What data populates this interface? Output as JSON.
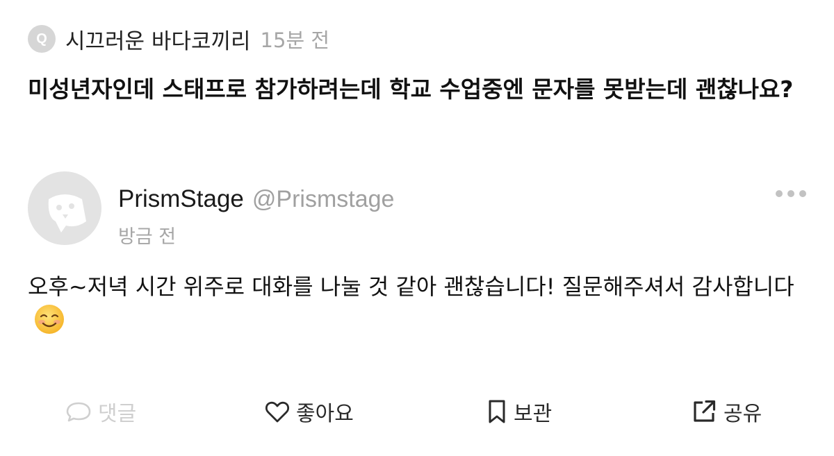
{
  "question": {
    "badge_letter": "Q",
    "asker_name": "시끄러운 바다코끼리",
    "time": "15분 전",
    "text": "미성년자인데 스태프로 참가하려는데 학교 수업중엔 문자를 못받는데 괜찮나요?"
  },
  "answer": {
    "author_name": "PrismStage",
    "author_handle": "@Prismstage",
    "time": "방금 전",
    "text": "오후~저녁 시간 위주로 대화를 나눌 것 같아 괜찮습니다! 질문해주셔서 감사합니다",
    "emoji_icon": "smiling-face-icon"
  },
  "actions": {
    "comment_label": "댓글",
    "like_label": "좋아요",
    "save_label": "보관",
    "share_label": "공유"
  },
  "colors": {
    "text_primary": "#111111",
    "text_muted": "#a6a6a6",
    "disabled": "#cfcfcf",
    "avatar_bg": "#e3e3e3"
  }
}
